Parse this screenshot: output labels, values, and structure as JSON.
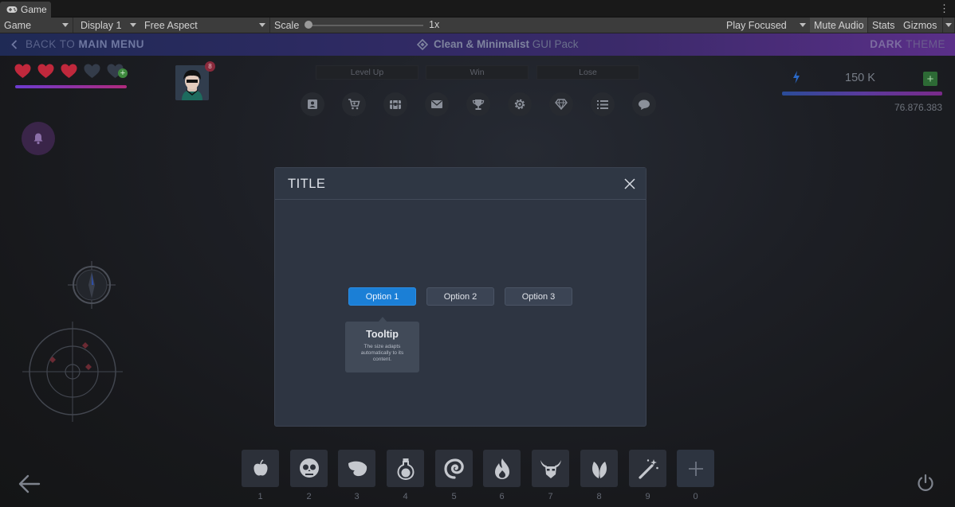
{
  "editor": {
    "tab_title": "Game",
    "tab_icon": "gamepad-icon",
    "tab_menu": "⋮",
    "toolbar": {
      "view_mode": "Game",
      "display": "Display 1",
      "aspect": "Free Aspect",
      "scale_label": "Scale",
      "scale_value": "1x",
      "play_mode": "Play Focused",
      "mute_audio": "Mute Audio",
      "stats": "Stats",
      "gizmos": "Gizmos"
    }
  },
  "game": {
    "topbar": {
      "back_prefix": "BACK TO",
      "back_strong": "MAIN MENU",
      "pack_strong": "Clean & Minimalist",
      "pack_rest": "GUI Pack",
      "theme_strong": "DARK",
      "theme_rest": "THEME"
    },
    "hearts": {
      "total": 5,
      "filled": 3,
      "fill_color": "#c0283c",
      "empty_color": "#343c4a"
    },
    "avatar_badge": "8",
    "top_tabs": [
      "Level Up",
      "Win",
      "Lose"
    ],
    "icons": [
      "contact-icon",
      "cart-icon",
      "chest-icon",
      "mail-icon",
      "trophy-icon",
      "gear-icon",
      "diamond-icon",
      "list-icon",
      "chat-icon"
    ],
    "currency": {
      "value": "150 K",
      "total": "76.876.383",
      "plus": "+"
    },
    "colors": {
      "accent": "#1b7fd6",
      "modal_bg": "#2e3542",
      "tooltip_bg": "#414a58"
    }
  },
  "modal": {
    "title": "TITLE",
    "options": [
      "Option 1",
      "Option 2",
      "Option 3"
    ],
    "selected_option": "Option 1",
    "tooltip": {
      "title": "Tooltip",
      "body": "The size adapts automatically to its content."
    }
  },
  "action_bar": {
    "slots": [
      {
        "icon": "apple-icon",
        "key": "1"
      },
      {
        "icon": "skull-icon",
        "key": "2"
      },
      {
        "icon": "wing-icon",
        "key": "3"
      },
      {
        "icon": "potion-icon",
        "key": "4"
      },
      {
        "icon": "swirl-icon",
        "key": "5"
      },
      {
        "icon": "fire-icon",
        "key": "6"
      },
      {
        "icon": "horned-helmet-icon",
        "key": "7"
      },
      {
        "icon": "leaf-icon",
        "key": "8"
      },
      {
        "icon": "magic-wand-icon",
        "key": "9"
      },
      {
        "icon": "plus-icon",
        "key": "0"
      }
    ]
  }
}
